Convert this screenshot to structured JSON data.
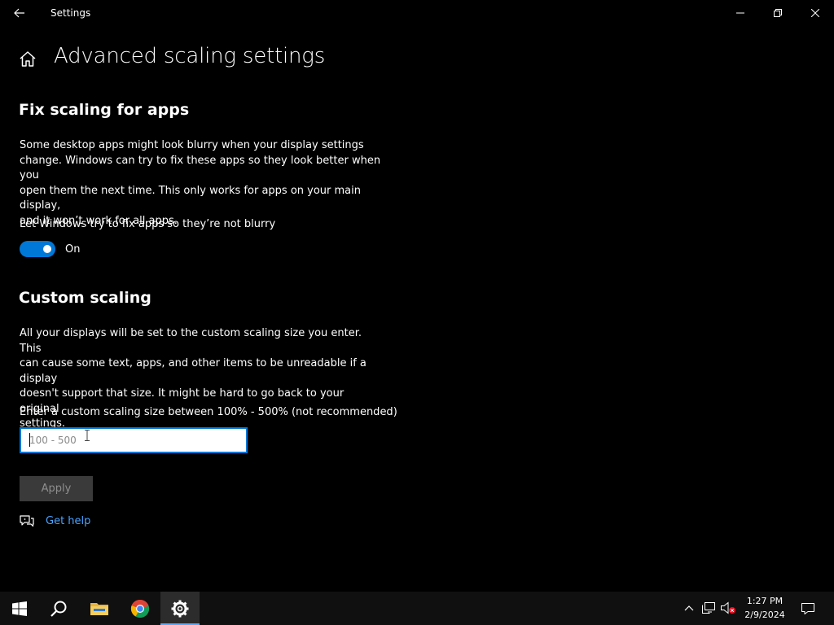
{
  "window": {
    "title": "Settings"
  },
  "page": {
    "title": "Advanced scaling settings"
  },
  "fix_scaling": {
    "heading": "Fix scaling for apps",
    "description_lines": [
      "Some desktop apps might look blurry when your display settings",
      "change. Windows can try to fix these apps so they look better when you",
      "open them the next time. This only works for apps on your main display,",
      "and it won’t work for all apps."
    ],
    "toggle_label": "Let Windows try to fix apps so they’re not blurry",
    "toggle_state": "On",
    "toggle_on": true
  },
  "custom_scaling": {
    "heading": "Custom scaling",
    "description_lines": [
      "All your displays will be set to the custom scaling size you enter. This",
      "can cause some text, apps, and other items to be unreadable if a display",
      "doesn't support that size. It might be hard to go back to your original",
      "settings."
    ],
    "input_label": "Enter a custom scaling size between 100% - 500% (not recommended)",
    "input_value": "",
    "input_placeholder": "100 - 500",
    "apply_label": "Apply"
  },
  "help": {
    "link_label": "Get help"
  },
  "taskbar": {
    "items": [
      "start-icon",
      "search-icon",
      "file-explorer-icon",
      "chrome-icon",
      "settings-icon"
    ],
    "active_item": "settings-icon",
    "clock_time": "1:27 PM",
    "clock_date": "2/9/2024"
  },
  "colors": {
    "accent": "#0078d7",
    "link": "#4aa3ff",
    "background": "#000000"
  }
}
